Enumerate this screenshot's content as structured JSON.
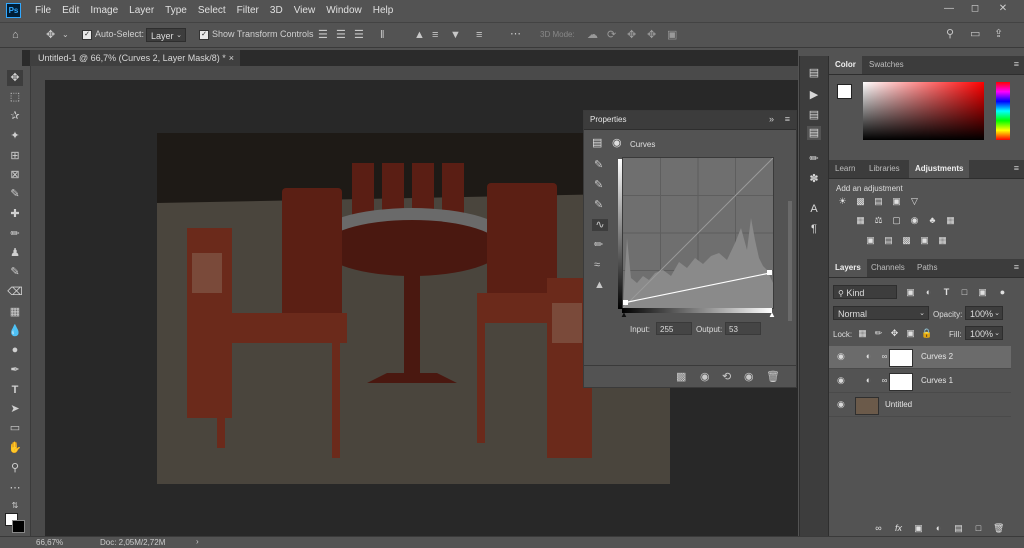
{
  "app": {
    "logo": "Ps"
  },
  "menu": [
    "File",
    "Edit",
    "Image",
    "Layer",
    "Type",
    "Select",
    "Filter",
    "3D",
    "View",
    "Window",
    "Help"
  ],
  "options_bar": {
    "auto_select_label": "Auto-Select:",
    "auto_select_value": "Layer",
    "show_transform_label": "Show Transform Controls",
    "mode_3d_label": "3D Mode:"
  },
  "document": {
    "tab_title": "Untitled-1 @ 66,7% (Curves 2, Layer Mask/8) *",
    "zoom": "66,67%",
    "doc_info": "Doc: 2,05M/2,72M"
  },
  "properties": {
    "title": "Properties",
    "adjustment_name": "Curves",
    "input_label": "Input:",
    "input_value": "255",
    "output_label": "Output:",
    "output_value": "53"
  },
  "color_panel": {
    "tabs": [
      "Color",
      "Swatches"
    ],
    "accent": "#ff0000"
  },
  "adjustments_panel": {
    "tabs": [
      "Learn",
      "Libraries",
      "Adjustments"
    ],
    "heading": "Add an adjustment"
  },
  "layers_panel": {
    "tabs": [
      "Layers",
      "Channels",
      "Paths"
    ],
    "filter_kind": "Kind",
    "blend_mode": "Normal",
    "opacity_label": "Opacity:",
    "opacity_value": "100%",
    "lock_label": "Lock:",
    "fill_label": "Fill:",
    "fill_value": "100%",
    "layers": [
      {
        "name": "Curves 2"
      },
      {
        "name": "Curves 1"
      },
      {
        "name": "Untitled"
      }
    ]
  }
}
